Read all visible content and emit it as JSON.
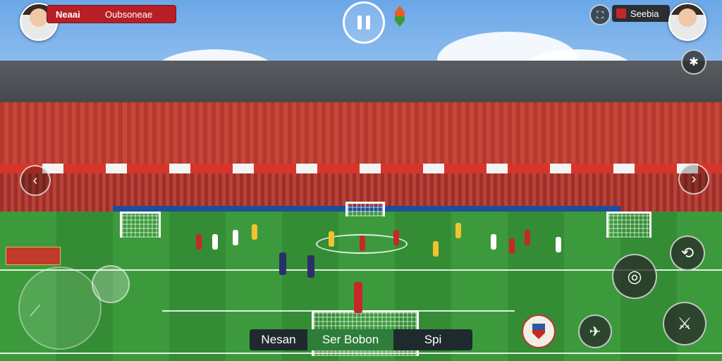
{
  "hud": {
    "left_player_name": "Neaai",
    "left_team_name": "Oubsoneae",
    "right_team_name": "Seebia",
    "bottom_left_label": "Nesan",
    "bottom_center_label": "Ser Bobon",
    "bottom_right_label": "Spi"
  },
  "icons": {
    "pause": "pause-icon",
    "settings": "gear-icon",
    "left_arrow": "chevron-left-icon",
    "right_arrow": "chevron-right-icon",
    "joystick": "joystick-icon",
    "shoot": "shoot-icon",
    "pass": "pass-icon",
    "tackle": "tackle-icon",
    "sprint": "sprint-icon",
    "swap": "swap-icon",
    "camera": "camera-icon"
  },
  "colors": {
    "home_red": "#b81f25",
    "away_yellow": "#f2c230",
    "pitch_green": "#3c9a3c"
  }
}
